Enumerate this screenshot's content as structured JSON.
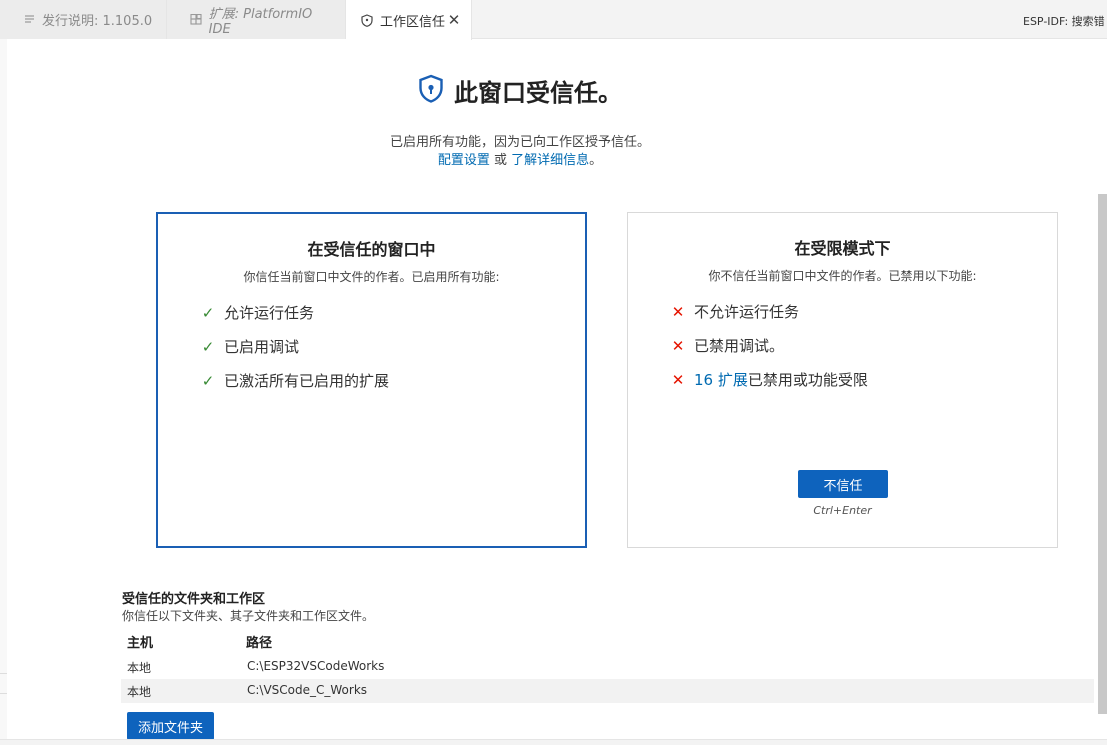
{
  "tabs": [
    {
      "label": "发行说明: 1.105.0",
      "icon": "list-icon"
    },
    {
      "label": "扩展: PlatformIO IDE",
      "icon": "extensions-icon"
    },
    {
      "label": "工作区信任",
      "icon": "shield-icon",
      "active": true
    }
  ],
  "status_right": "ESP-IDF: 搜索错",
  "header": {
    "title": "此窗口受信任。",
    "subtitle": "已启用所有功能，因为已向工作区授予信任。",
    "configure_link": "配置设置",
    "or_text": " 或 ",
    "learn_more_link": "了解详细信息",
    "period": "。"
  },
  "trusted_card": {
    "title": "在受信任的窗口中",
    "description": "你信任当前窗口中文件的作者。已启用所有功能:",
    "features": [
      "允许运行任务",
      "已启用调试",
      "已激活所有已启用的扩展"
    ]
  },
  "restricted_card": {
    "title": "在受限模式下",
    "description": "你不信任当前窗口中文件的作者。已禁用以下功能:",
    "features": [
      "不允许运行任务",
      "已禁用调试。"
    ],
    "extensions_link": "16 扩展",
    "extensions_suffix": "已禁用或功能受限",
    "button": "不信任",
    "shortcut": "Ctrl+Enter"
  },
  "trusted_folders": {
    "title": "受信任的文件夹和工作区",
    "description": "你信任以下文件夹、其子文件夹和工作区文件。",
    "columns": [
      "主机",
      "路径"
    ],
    "rows": [
      {
        "host": "本地",
        "path": "C:\\ESP32VSCodeWorks"
      },
      {
        "host": "本地",
        "path": "C:\\VSCode_C_Works"
      }
    ],
    "add_button": "添加文件夹"
  },
  "colors": {
    "accent": "#0e63bd",
    "link": "#006ab1",
    "check": "#388a34",
    "cross": "#e51400"
  }
}
